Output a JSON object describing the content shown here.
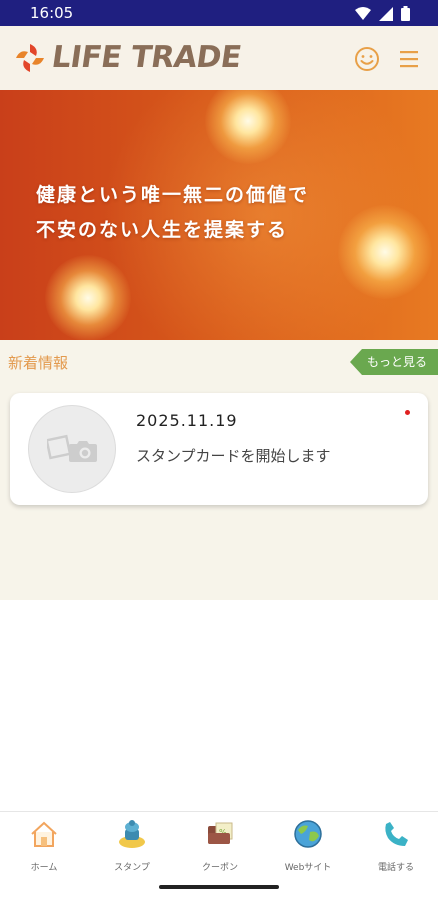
{
  "status_bar": {
    "time": "16:05"
  },
  "header": {
    "logo_text": "LIFE TRADE"
  },
  "hero": {
    "line1": "健康という唯一無二の価値で",
    "line2": "不安のない人生を提案する"
  },
  "news": {
    "title": "新着情報",
    "more_label": "もっと見る",
    "items": [
      {
        "date": "2025.11.19",
        "text": "スタンプカードを開始します",
        "unread": true
      }
    ]
  },
  "nav": {
    "items": [
      {
        "label": "ホーム",
        "icon": "home-icon"
      },
      {
        "label": "スタンプ",
        "icon": "stamp-icon"
      },
      {
        "label": "クーポン",
        "icon": "coupon-icon"
      },
      {
        "label": "Webサイト",
        "icon": "globe-icon"
      },
      {
        "label": "電話する",
        "icon": "phone-icon"
      }
    ]
  },
  "colors": {
    "status_bar": "#1f1f80",
    "accent_orange": "#e39a4e",
    "more_green": "#6aa84f",
    "hero_red": "#c93f1a"
  }
}
